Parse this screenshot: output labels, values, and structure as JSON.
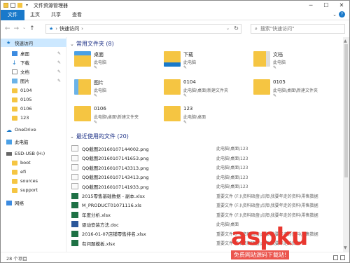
{
  "window": {
    "title": "文件资源管理器"
  },
  "ribbon": {
    "tabs": [
      "文件",
      "主页",
      "共享",
      "查看"
    ]
  },
  "address": {
    "location": "快速访问",
    "search_placeholder": "搜索\"快速访问\""
  },
  "sidebar": {
    "items": [
      {
        "label": "快速访问",
        "icon": "star-icon",
        "selected": true
      },
      {
        "label": "桌面",
        "icon": "desktop-icon",
        "pinned": true
      },
      {
        "label": "下载",
        "icon": "download-icon",
        "pinned": true
      },
      {
        "label": "文档",
        "icon": "document-icon",
        "pinned": true
      },
      {
        "label": "图片",
        "icon": "picture-icon",
        "pinned": true
      },
      {
        "label": "0104",
        "icon": "folder-icon"
      },
      {
        "label": "0105",
        "icon": "folder-icon"
      },
      {
        "label": "0106",
        "icon": "folder-icon"
      },
      {
        "label": "123",
        "icon": "folder-icon"
      },
      {
        "label": "OneDrive",
        "icon": "cloud-icon"
      },
      {
        "label": "此电脑",
        "icon": "computer-icon"
      },
      {
        "label": "ESD-USB (H:)",
        "icon": "usb-drive-icon"
      },
      {
        "label": "boot",
        "icon": "folder-icon"
      },
      {
        "label": "efi",
        "icon": "folder-icon"
      },
      {
        "label": "sources",
        "icon": "folder-icon"
      },
      {
        "label": "support",
        "icon": "folder-icon"
      },
      {
        "label": "网络",
        "icon": "network-icon"
      }
    ]
  },
  "frequent": {
    "header": "常用文件夹 (8)",
    "items": [
      {
        "name": "桌面",
        "path": "此电脑",
        "icon": "desktop-folder-icon"
      },
      {
        "name": "下载",
        "path": "此电脑",
        "icon": "download-folder-icon"
      },
      {
        "name": "文档",
        "path": "此电脑",
        "icon": "document-folder-icon"
      },
      {
        "name": "图片",
        "path": "此电脑",
        "icon": "picture-folder-icon"
      },
      {
        "name": "0104",
        "path": "此电脑\\桌面\\新建文件夹",
        "icon": "folder-icon"
      },
      {
        "name": "0105",
        "path": "此电脑\\桌面\\新建文件夹",
        "icon": "folder-icon"
      },
      {
        "name": "0106",
        "path": "此电脑\\桌面\\新建文件夹",
        "icon": "folder-icon"
      },
      {
        "name": "123",
        "path": "此电脑\\桌面",
        "icon": "folder-icon"
      }
    ]
  },
  "recent": {
    "header": "最近使用的文件 (20)",
    "items": [
      {
        "name": "QQ截图20160107144002.png",
        "location": "此电脑\\桌面\\123",
        "type": "png"
      },
      {
        "name": "QQ截图20160107141653.png",
        "location": "此电脑\\桌面\\123",
        "type": "png"
      },
      {
        "name": "QQ截图20160107143313.png",
        "location": "此电脑\\桌面\\123",
        "type": "png"
      },
      {
        "name": "QQ截图20160107143413.png",
        "location": "此电脑\\桌面\\123",
        "type": "png"
      },
      {
        "name": "QQ截图20160107141933.png",
        "location": "此电脑\\桌面\\123",
        "type": "png"
      },
      {
        "name": "2015零售基础数据 - 副本.xlsx",
        "location": "重要文件 (F:)\\资料硕盘\\点拜\\我要年走的资料\\零售数据",
        "type": "xls"
      },
      {
        "name": "M_PRODUCT01071116.xls",
        "location": "重要文件 (F:)\\资料硕盘\\点拜\\我要年走的资料\\零售数据",
        "type": "xls"
      },
      {
        "name": "年度分析.xlsx",
        "location": "重要文件 (F:)\\资料硕盘\\点拜\\我要年走的资料\\零售数据",
        "type": "xls"
      },
      {
        "name": "驱动安装方法.doc",
        "location": "此电脑\\桌面",
        "type": "doc"
      },
      {
        "name": "2016-01-07店铺零售排名.xlsx",
        "location": "重要文件 (F:)\\资料硕盘\\点拜\\我要年走的资料\\零售数据",
        "type": "xls"
      },
      {
        "name": "有问题模板.xlsx",
        "location": "重要文件 (F:)\\资料硕盘\\点拜\\我要年走的资料",
        "type": "xls"
      }
    ]
  },
  "status": {
    "count": "28 个项目"
  },
  "watermark": {
    "brand": "aspku",
    "sub": "免费网站源码下载站!"
  }
}
